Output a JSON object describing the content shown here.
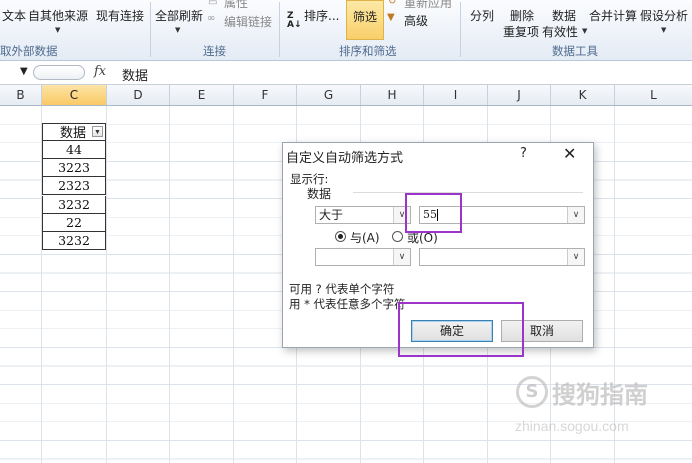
{
  "ribbon": {
    "buttons": {
      "text": "文本",
      "other_sources": "自其他来源",
      "existing_connections": "现有连接",
      "refresh_all": "全部刷新",
      "properties": "属性",
      "edit_links": "编辑链接",
      "sort": "排序...",
      "filter": "筛选",
      "reapply": "重新应用",
      "advanced": "高级",
      "split": "分列",
      "remove_dup_line1": "删除",
      "remove_dup_line2": "重复项",
      "validation_line1": "数据",
      "validation_line2": "有效性",
      "consolidate": "合并计算",
      "what_if": "假设分析"
    },
    "groups": {
      "external": "取外部数据",
      "connections": "连接",
      "sort_filter": "排序和筛选",
      "data_tools": "数据工具"
    }
  },
  "formula_bar": {
    "fx": "fx",
    "value": "数据"
  },
  "columns": [
    "B",
    "C",
    "D",
    "E",
    "F",
    "G",
    "H",
    "I",
    "J",
    "K",
    "L"
  ],
  "sheet": {
    "header": "数据",
    "values": [
      "44",
      "3223",
      "2323",
      "3232",
      "22",
      "3232"
    ]
  },
  "dialog": {
    "title": "自定义自动筛选方式",
    "help": "?",
    "close": "✕",
    "show_rows": "显示行:",
    "field": "数据",
    "op1": "大于",
    "val1": "55",
    "op2": "",
    "val2": "",
    "and_label": "与(A)",
    "or_label": "或(O)",
    "hint1": "可用 ? 代表单个字符",
    "hint2": "用 * 代表任意多个字符",
    "ok": "确定",
    "cancel": "取消"
  },
  "watermark": {
    "brand": "搜狗指南",
    "url": "zhinan.sogou.com"
  },
  "colors": {
    "highlight": "#9b34c9",
    "selected_header": "#f9c965"
  }
}
